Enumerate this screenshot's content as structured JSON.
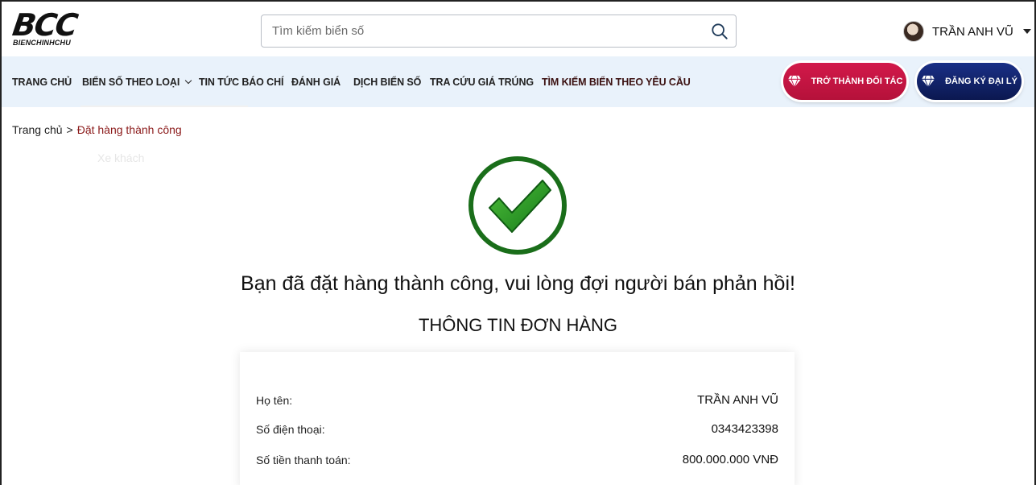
{
  "header": {
    "logo_text": "BCC",
    "logo_subtext": "BIENCHINHCHU",
    "search_placeholder": "Tìm kiếm biển số",
    "user_name": "TRẦN ANH VŨ"
  },
  "nav": {
    "items": [
      {
        "label": "TRANG CHỦ"
      },
      {
        "label": "BIỂN SỐ THEO LOẠI"
      },
      {
        "label": "TIN TỨC BÁO CHÍ"
      },
      {
        "label": "ĐÁNH GIÁ"
      },
      {
        "label": "DỊCH BIỂN SỐ"
      },
      {
        "label": "TRA CỨU GIÁ TRÚNG"
      },
      {
        "label": "TÌM KIẾM BIỂN THEO YÊU CẦU"
      }
    ],
    "partner_button": "TRỞ THÀNH ĐỐI TÁC",
    "agency_button": "ĐĂNG KÝ ĐẠI LÝ",
    "dropdown_ghost_item": "Xe khách"
  },
  "breadcrumb": {
    "home": "Trang chủ",
    "separator": ">",
    "current": "Đặt hàng thành công"
  },
  "success": {
    "message": "Bạn đã đặt hàng thành công, vui lòng đợi người bán phản hồi!",
    "section_title": "THÔNG TIN ĐƠN HÀNG"
  },
  "order": {
    "rows": [
      {
        "label": "Họ tên:",
        "value": "TRẦN ANH VŨ"
      },
      {
        "label": "Số điện thoại:",
        "value": "0343423398"
      },
      {
        "label": "Số tiền thanh toán:",
        "value": "800.000.000 VNĐ"
      }
    ]
  },
  "colors": {
    "nav_bg": "#e9f2fb",
    "partner_button": "#c8154a",
    "agency_button": "#12226a",
    "check_green": "#1d7a1d",
    "breadcrumb_current": "#8b1a1a"
  },
  "icons": [
    "search-icon",
    "diamond-icon",
    "check-circle-icon",
    "caret-down-icon",
    "chevron-down-icon"
  ]
}
